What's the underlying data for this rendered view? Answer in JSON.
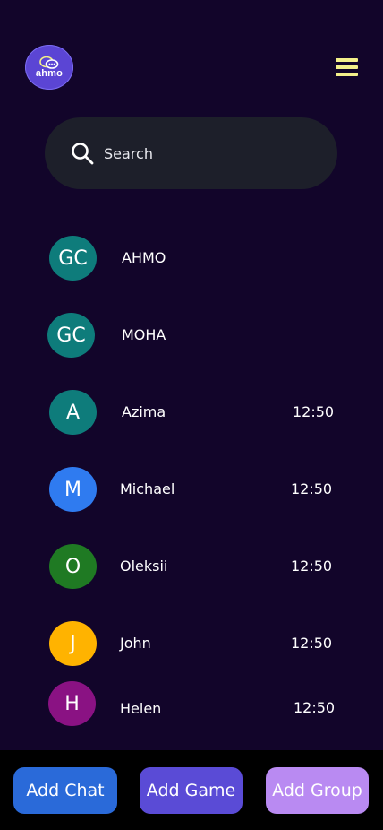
{
  "header": {
    "logo_text": "ahmo",
    "menu_icon": "hamburger-menu-icon"
  },
  "search": {
    "placeholder": "Search",
    "icon": "search-icon"
  },
  "chats": [
    {
      "initials": "GC",
      "name": "AHMO",
      "time": "",
      "color": "#0e7c7b"
    },
    {
      "initials": "GC",
      "name": "MOHA",
      "time": "",
      "color": "#0e7c7b"
    },
    {
      "initials": "A",
      "name": "Azima",
      "time": "12:50",
      "color": "#0e7c7b"
    },
    {
      "initials": "M",
      "name": "Michael",
      "time": "12:50",
      "color": "#2f7bf0"
    },
    {
      "initials": "O",
      "name": "Oleksii",
      "time": "12:50",
      "color": "#1f7a23"
    },
    {
      "initials": "J",
      "name": "John",
      "time": "12:50",
      "color": "#ffb300"
    },
    {
      "initials": "H",
      "name": "Helen",
      "time": "12:50",
      "color": "#8a1283"
    }
  ],
  "actions": {
    "add_chat": "Add Chat",
    "add_game": "Add Game",
    "add_group": "Add Group"
  },
  "colors": {
    "background": "#12052a",
    "search_bg": "#1d1f2a",
    "menu_accent": "#f3f08a",
    "add_chat_bg": "#2a6ad9",
    "add_game_bg": "#5a4bd6",
    "add_group_bg": "#b98af2"
  }
}
